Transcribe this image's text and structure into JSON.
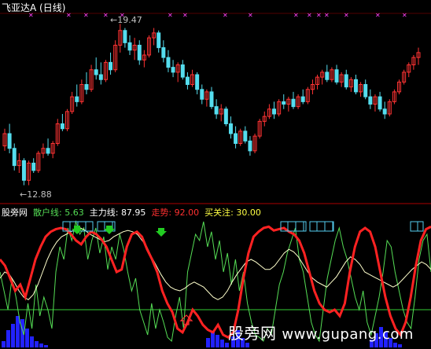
{
  "window": {
    "title": "飞亚达A (日线)"
  },
  "price_chart": {
    "high_label": "19.47",
    "low_label": "12.88",
    "candles": [
      [
        14.5,
        15.2,
        14.3,
        15.0
      ],
      [
        15.0,
        15.4,
        14.2,
        14.4
      ],
      [
        14.4,
        14.6,
        13.5,
        13.7
      ],
      [
        13.7,
        14.2,
        13.4,
        13.9
      ],
      [
        13.9,
        14.0,
        12.9,
        13.1
      ],
      [
        13.1,
        13.9,
        12.9,
        13.8
      ],
      [
        13.8,
        14.0,
        13.4,
        13.5
      ],
      [
        13.5,
        14.3,
        13.4,
        14.2
      ],
      [
        14.2,
        14.6,
        14.0,
        14.4
      ],
      [
        14.4,
        14.8,
        14.1,
        14.2
      ],
      [
        14.2,
        14.7,
        14.0,
        14.6
      ],
      [
        14.6,
        15.6,
        14.5,
        15.4
      ],
      [
        15.4,
        15.8,
        15.1,
        15.2
      ],
      [
        15.2,
        16.0,
        15.1,
        15.9
      ],
      [
        15.9,
        16.7,
        15.8,
        16.5
      ],
      [
        16.5,
        17.0,
        16.1,
        16.3
      ],
      [
        16.3,
        17.2,
        16.2,
        17.0
      ],
      [
        17.0,
        17.5,
        16.6,
        16.8
      ],
      [
        16.8,
        17.8,
        16.7,
        17.6
      ],
      [
        17.6,
        18.1,
        17.2,
        17.4
      ],
      [
        17.4,
        17.9,
        17.0,
        17.2
      ],
      [
        17.2,
        18.0,
        17.1,
        17.9
      ],
      [
        17.9,
        18.3,
        17.4,
        17.6
      ],
      [
        17.6,
        18.8,
        17.5,
        18.6
      ],
      [
        18.6,
        19.47,
        18.3,
        19.2
      ],
      [
        19.2,
        19.3,
        18.5,
        18.7
      ],
      [
        18.7,
        19.0,
        18.2,
        18.4
      ],
      [
        18.4,
        18.9,
        18.0,
        18.6
      ],
      [
        18.6,
        18.8,
        17.8,
        18.0
      ],
      [
        18.0,
        18.4,
        17.7,
        18.2
      ],
      [
        18.2,
        19.0,
        18.1,
        18.9
      ],
      [
        18.9,
        19.3,
        18.6,
        19.1
      ],
      [
        19.1,
        19.2,
        18.3,
        18.5
      ],
      [
        18.5,
        18.8,
        17.9,
        18.1
      ],
      [
        18.1,
        18.4,
        17.5,
        17.7
      ],
      [
        17.7,
        18.0,
        17.3,
        17.5
      ],
      [
        17.5,
        17.9,
        17.1,
        17.8
      ],
      [
        17.8,
        18.0,
        17.2,
        17.3
      ],
      [
        17.3,
        17.5,
        16.8,
        17.0
      ],
      [
        17.0,
        17.6,
        16.9,
        17.4
      ],
      [
        17.4,
        17.5,
        16.6,
        16.8
      ],
      [
        16.8,
        17.0,
        16.2,
        16.4
      ],
      [
        16.4,
        16.8,
        16.1,
        16.7
      ],
      [
        16.7,
        16.9,
        16.0,
        16.1
      ],
      [
        16.1,
        16.4,
        15.6,
        15.8
      ],
      [
        15.8,
        16.2,
        15.5,
        16.0
      ],
      [
        16.0,
        16.1,
        15.3,
        15.4
      ],
      [
        15.4,
        15.7,
        14.8,
        15.0
      ],
      [
        15.0,
        15.3,
        14.4,
        14.6
      ],
      [
        14.6,
        15.2,
        14.5,
        15.1
      ],
      [
        15.1,
        15.3,
        14.6,
        14.7
      ],
      [
        14.7,
        14.9,
        14.1,
        14.3
      ],
      [
        14.3,
        15.0,
        14.2,
        14.9
      ],
      [
        14.9,
        15.6,
        14.8,
        15.5
      ],
      [
        15.5,
        15.9,
        15.3,
        15.7
      ],
      [
        15.7,
        16.2,
        15.6,
        16.0
      ],
      [
        16.0,
        16.3,
        15.6,
        15.8
      ],
      [
        15.8,
        16.4,
        15.7,
        16.3
      ],
      [
        16.3,
        16.6,
        16.0,
        16.2
      ],
      [
        16.2,
        16.5,
        15.9,
        16.4
      ],
      [
        16.4,
        16.7,
        16.0,
        16.1
      ],
      [
        16.1,
        16.6,
        16.0,
        16.5
      ],
      [
        16.5,
        16.8,
        16.2,
        16.3
      ],
      [
        16.3,
        16.9,
        16.2,
        16.8
      ],
      [
        16.8,
        17.2,
        16.6,
        17.0
      ],
      [
        17.0,
        17.4,
        16.8,
        17.3
      ],
      [
        17.3,
        17.6,
        17.0,
        17.5
      ],
      [
        17.5,
        17.8,
        17.1,
        17.2
      ],
      [
        17.2,
        17.7,
        17.1,
        17.6
      ],
      [
        17.6,
        17.8,
        17.0,
        17.1
      ],
      [
        17.1,
        17.5,
        16.9,
        17.4
      ],
      [
        17.4,
        17.6,
        16.8,
        16.9
      ],
      [
        16.9,
        17.3,
        16.7,
        17.2
      ],
      [
        17.2,
        17.4,
        16.6,
        16.7
      ],
      [
        16.7,
        17.1,
        16.5,
        17.0
      ],
      [
        17.0,
        17.2,
        16.4,
        16.5
      ],
      [
        16.5,
        16.8,
        16.0,
        16.2
      ],
      [
        16.2,
        16.6,
        15.9,
        16.5
      ],
      [
        16.5,
        16.7,
        15.9,
        16.0
      ],
      [
        16.0,
        16.3,
        15.6,
        15.8
      ],
      [
        15.8,
        16.4,
        15.7,
        16.3
      ],
      [
        16.3,
        16.8,
        16.2,
        16.7
      ],
      [
        16.7,
        17.2,
        16.6,
        17.1
      ],
      [
        17.1,
        17.6,
        17.0,
        17.5
      ],
      [
        17.5,
        17.9,
        17.3,
        17.8
      ],
      [
        17.8,
        18.2,
        17.6,
        18.1
      ],
      [
        18.1,
        18.5,
        17.8,
        18.3
      ]
    ]
  },
  "indicator": {
    "name": "股旁网",
    "retail_label": "散户线:",
    "retail_value": "5.63",
    "main_label": "主力线:",
    "main_value": "87.95",
    "trend_label": "走势:",
    "trend_value": "92.00",
    "buy_label": "买关注:",
    "buy_value": "30.00",
    "colors": {
      "retail": "#55dd55",
      "main": "#ffffcc",
      "trend": "#ff2222",
      "buy_line": "#33cc33",
      "volume": "#2222ff",
      "marker_box": "#55ccee",
      "down_arrow": "#22cc22",
      "up_arrow": "#ff3333",
      "x_mark": "#ff44ff",
      "candle_up": "#ff3333",
      "candle_down": "#55ddee"
    }
  },
  "watermark": {
    "text": "股旁网 ",
    "url": "www.gupang.com"
  }
}
